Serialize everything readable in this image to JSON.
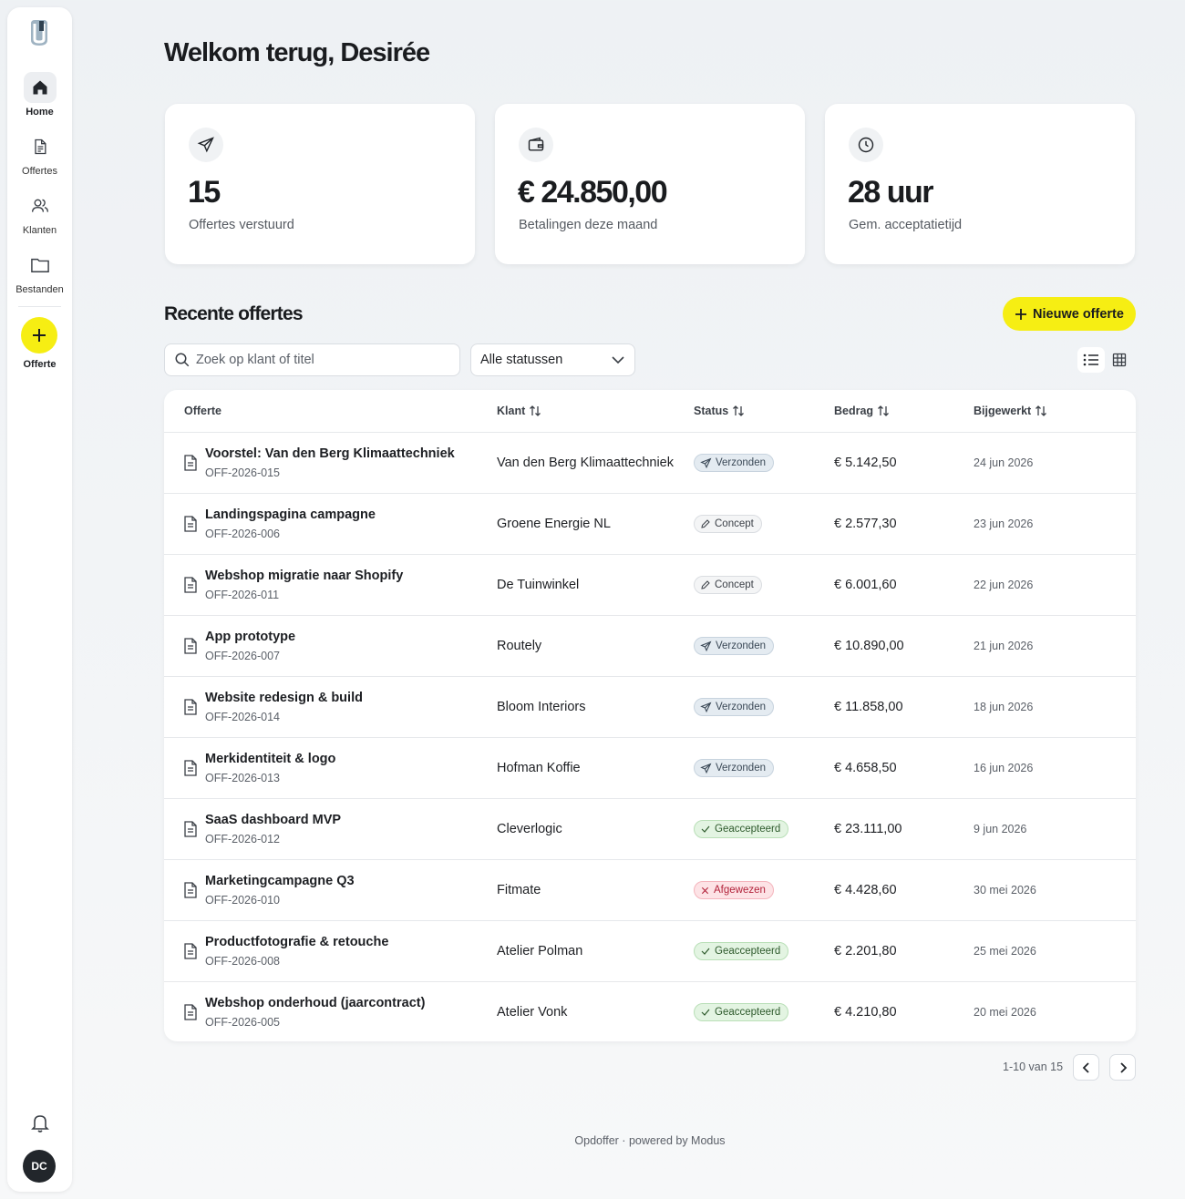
{
  "sidebar": {
    "items": [
      {
        "label": "Home",
        "icon": "home-icon"
      },
      {
        "label": "Offertes",
        "icon": "document-icon"
      },
      {
        "label": "Klanten",
        "icon": "users-icon"
      },
      {
        "label": "Bestanden",
        "icon": "folder-icon"
      }
    ],
    "fab_label": "Offerte",
    "avatar_initials": "DC"
  },
  "header": {
    "title": "Welkom terug, Desirée"
  },
  "stats": [
    {
      "icon": "send-icon",
      "value": "15",
      "label": "Offertes verstuurd"
    },
    {
      "icon": "wallet-icon",
      "value": "€ 24.850,00",
      "label": "Betalingen deze maand"
    },
    {
      "icon": "clock-icon",
      "value": "28 uur",
      "label": "Gem. acceptatietijd"
    }
  ],
  "section": {
    "title": "Recente offertes",
    "new_button": "Nieuwe offerte",
    "search_placeholder": "Zoek op klant of titel",
    "status_filter": "Alle statussen"
  },
  "table": {
    "columns": [
      "Offerte",
      "Klant",
      "Status",
      "Bedrag",
      "Bijgewerkt"
    ],
    "rows": [
      {
        "title": "Voorstel: Van den Berg Klimaattechniek",
        "code": "OFF-2026-015",
        "client": "Van den Berg Klimaattechniek",
        "status": "Verzonden",
        "amount": "€ 5.142,50",
        "date": "24 jun 2026"
      },
      {
        "title": "Landingspagina campagne",
        "code": "OFF-2026-006",
        "client": "Groene Energie NL",
        "status": "Concept",
        "amount": "€ 2.577,30",
        "date": "23 jun 2026"
      },
      {
        "title": "Webshop migratie naar Shopify",
        "code": "OFF-2026-011",
        "client": "De Tuinwinkel",
        "status": "Concept",
        "amount": "€ 6.001,60",
        "date": "22 jun 2026"
      },
      {
        "title": "App prototype",
        "code": "OFF-2026-007",
        "client": "Routely",
        "status": "Verzonden",
        "amount": "€ 10.890,00",
        "date": "21 jun 2026"
      },
      {
        "title": "Website redesign & build",
        "code": "OFF-2026-014",
        "client": "Bloom Interiors",
        "status": "Verzonden",
        "amount": "€ 11.858,00",
        "date": "18 jun 2026"
      },
      {
        "title": "Merkidentiteit & logo",
        "code": "OFF-2026-013",
        "client": "Hofman Koffie",
        "status": "Verzonden",
        "amount": "€ 4.658,50",
        "date": "16 jun 2026"
      },
      {
        "title": "SaaS dashboard MVP",
        "code": "OFF-2026-012",
        "client": "Cleverlogic",
        "status": "Geaccepteerd",
        "amount": "€ 23.111,00",
        "date": "9 jun 2026"
      },
      {
        "title": "Marketingcampagne Q3",
        "code": "OFF-2026-010",
        "client": "Fitmate",
        "status": "Afgewezen",
        "amount": "€ 4.428,60",
        "date": "30 mei 2026"
      },
      {
        "title": "Productfotografie & retouche",
        "code": "OFF-2026-008",
        "client": "Atelier Polman",
        "status": "Geaccepteerd",
        "amount": "€ 2.201,80",
        "date": "25 mei 2026"
      },
      {
        "title": "Webshop onderhoud (jaarcontract)",
        "code": "OFF-2026-005",
        "client": "Atelier Vonk",
        "status": "Geaccepteerd",
        "amount": "€ 4.210,80",
        "date": "20 mei 2026"
      }
    ]
  },
  "pagination": {
    "label": "1-10 van 15"
  },
  "footer": {
    "text": "Opdoffer · powered by Modus"
  },
  "colors": {
    "accent": "#f6ee13",
    "sent": "#e4ebf1",
    "accepted": "#e3f4e2",
    "rejected": "#fde3e6"
  }
}
